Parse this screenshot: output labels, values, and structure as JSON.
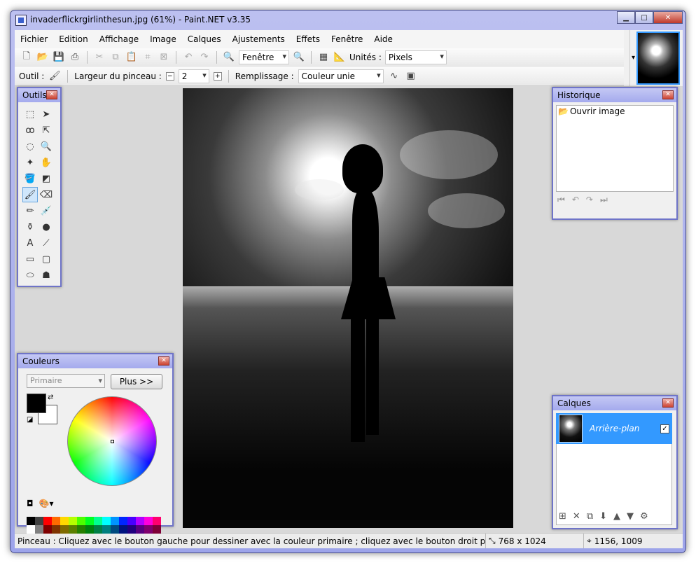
{
  "window": {
    "title": "invaderflickrgirlinthesun.jpg (61%) - Paint.NET v3.35",
    "minimize": "▁",
    "maximize": "□",
    "close": "✕"
  },
  "menu": [
    "Fichier",
    "Edition",
    "Affichage",
    "Image",
    "Calques",
    "Ajustements",
    "Effets",
    "Fenêtre",
    "Aide"
  ],
  "toolbar1": {
    "zoom_value": "Fenêtre",
    "units_label": "Unités :",
    "units_value": "Pixels"
  },
  "toolbar2": {
    "tool_label": "Outil :",
    "brush_width_label": "Largeur du pinceau :",
    "brush_width_value": "2",
    "fill_label": "Remplissage :",
    "fill_value": "Couleur unie"
  },
  "panels": {
    "tools_title": "Outils",
    "history_title": "Historique",
    "history_items": [
      "Ouvrir image"
    ],
    "colors_title": "Couleurs",
    "colors_mode": "Primaire",
    "colors_more": "Plus >>",
    "layers_title": "Calques",
    "layer_name": "Arrière-plan",
    "layer_visible": "✓"
  },
  "palette_top": [
    "#000000",
    "#404040",
    "#ff0000",
    "#ff6a00",
    "#ffd800",
    "#b6ff00",
    "#4cff00",
    "#00ff21",
    "#00ff90",
    "#00ffff",
    "#0094ff",
    "#0026ff",
    "#4800ff",
    "#b200ff",
    "#ff00dc",
    "#ff006e"
  ],
  "palette_bottom": [
    "#ffffff",
    "#808080",
    "#7f0000",
    "#7f3300",
    "#7f6a00",
    "#5b7f00",
    "#267f00",
    "#007f0e",
    "#007f46",
    "#007f7f",
    "#004a7f",
    "#00137f",
    "#21007f",
    "#57007f",
    "#7f006e",
    "#7f0037"
  ],
  "status": {
    "message": "Pinceau : Cliquez avec le bouton gauche pour dessiner avec la couleur primaire ; cliquez avec le bouton droit pour dessiner avec",
    "image_size": "768 x 1024",
    "cursor_pos": "1156, 1009"
  }
}
